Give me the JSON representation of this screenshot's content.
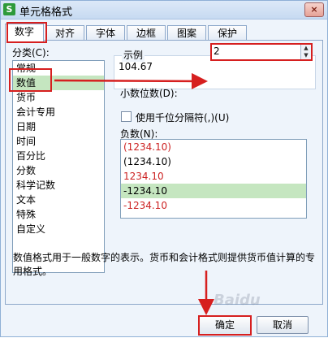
{
  "window": {
    "title": "单元格格式",
    "app_icon": "S",
    "close_label": "×"
  },
  "tabs": [
    {
      "label": "数字",
      "active": true
    },
    {
      "label": "对齐",
      "active": false
    },
    {
      "label": "字体",
      "active": false
    },
    {
      "label": "边框",
      "active": false
    },
    {
      "label": "图案",
      "active": false
    },
    {
      "label": "保护",
      "active": false
    }
  ],
  "category": {
    "label": "分类(C):",
    "items": [
      "常规",
      "数值",
      "货币",
      "会计专用",
      "日期",
      "时间",
      "百分比",
      "分数",
      "科学记数",
      "文本",
      "特殊",
      "自定义"
    ],
    "selected": "数值"
  },
  "sample": {
    "label": "示例",
    "value": "104.67"
  },
  "decimal": {
    "label": "小数位数(D):",
    "value": "2"
  },
  "separator": {
    "label": "使用千位分隔符(,)(U)",
    "checked": false
  },
  "negative": {
    "label": "负数(N):",
    "items": [
      {
        "text": "(1234.10)",
        "color": "#cc2222"
      },
      {
        "text": "(1234.10)",
        "color": "#000000"
      },
      {
        "text": "1234.10",
        "color": "#cc2222"
      },
      {
        "text": "-1234.10",
        "color": "#000000",
        "selected": true
      },
      {
        "text": "-1234.10",
        "color": "#cc2222"
      }
    ]
  },
  "description": "数值格式用于一般数字的表示。货币和会计格式则提供货币值计算的专用格式。",
  "buttons": {
    "ok": "确定",
    "cancel": "取消"
  },
  "watermark": "Baidu",
  "colors": {
    "highlight_red": "#d61f1f",
    "selection_green": "#c5e6c0",
    "dialog_bg": "#eef4fb"
  }
}
